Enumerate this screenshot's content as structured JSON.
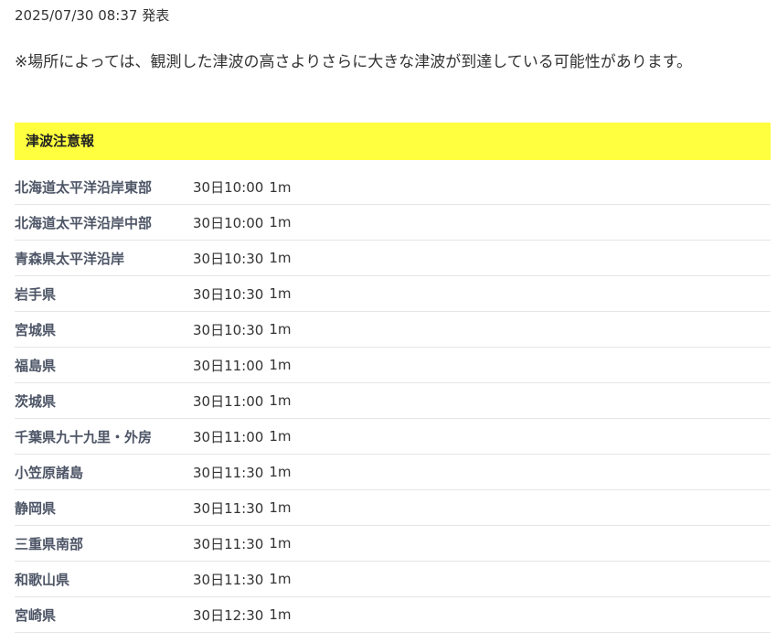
{
  "announcement": {
    "timestamp": "2025/07/30 08:37 発表",
    "note": "※場所によっては、観測した津波の高さよりさらに大きな津波が到達している可能性があります。"
  },
  "alert": {
    "level_label": "津波注意報",
    "level_color": "#ffff3f"
  },
  "regions": [
    {
      "name": "北海道太平洋沿岸東部",
      "time": "30日10:00",
      "height": "1m"
    },
    {
      "name": "北海道太平洋沿岸中部",
      "time": "30日10:00",
      "height": "1m"
    },
    {
      "name": "青森県太平洋沿岸",
      "time": "30日10:30",
      "height": "1m"
    },
    {
      "name": "岩手県",
      "time": "30日10:30",
      "height": "1m"
    },
    {
      "name": "宮城県",
      "time": "30日10:30",
      "height": "1m"
    },
    {
      "name": "福島県",
      "time": "30日11:00",
      "height": "1m"
    },
    {
      "name": "茨城県",
      "time": "30日11:00",
      "height": "1m"
    },
    {
      "name": "千葉県九十九里・外房",
      "time": "30日11:00",
      "height": "1m"
    },
    {
      "name": "小笠原諸島",
      "time": "30日11:30",
      "height": "1m"
    },
    {
      "name": "静岡県",
      "time": "30日11:30",
      "height": "1m"
    },
    {
      "name": "三重県南部",
      "time": "30日11:30",
      "height": "1m"
    },
    {
      "name": "和歌山県",
      "time": "30日11:30",
      "height": "1m"
    },
    {
      "name": "宮崎県",
      "time": "30日12:30",
      "height": "1m"
    }
  ]
}
